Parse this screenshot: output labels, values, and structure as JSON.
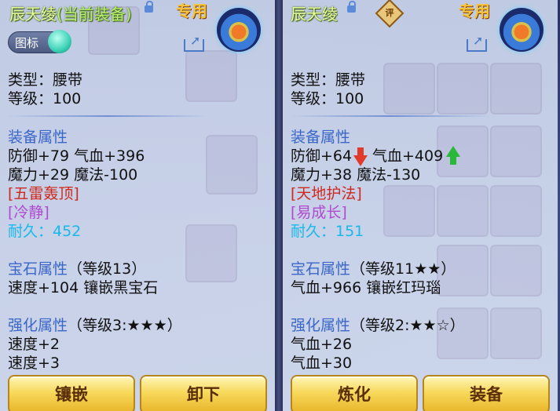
{
  "left": {
    "name": "辰天绫",
    "status": "(当前装备)",
    "exclusive": "专用",
    "tag_label": "图标",
    "type_line": "类型：腰带",
    "level_line": "等级：100",
    "attr_title": "装备属性",
    "attr_line1": "防御+79 气血+396",
    "attr_line2": "魔力+29 魔法-100",
    "skill": "[五雷轰顶]",
    "special": "[冷静]",
    "durability": "耐久：452",
    "gem_title": "宝石属性",
    "gem_level": "（等级13）",
    "gem_line": "速度+104 镶嵌黑宝石",
    "enh_title": "强化属性",
    "enh_level": "（等级3:★★★）",
    "enh_line1": "速度+2",
    "enh_line2": "速度+3",
    "btn1": "镶嵌",
    "btn2": "卸下"
  },
  "right": {
    "name": "辰天绫",
    "rating": "评",
    "exclusive": "专用",
    "type_line": "类型：腰带",
    "level_line": "等级：100",
    "attr_title": "装备属性",
    "attr_line1a": "防御+64",
    "attr_line1b": "气血+409",
    "attr_line2": "魔力+38 魔法-130",
    "skill": "[天地护法]",
    "special": "[易成长]",
    "durability": "耐久：151",
    "gem_title": "宝石属性",
    "gem_level": "（等级11★★）",
    "gem_line": "气血+966 镶嵌红玛瑙",
    "enh_title": "强化属性",
    "enh_level": "（等级2:★★☆）",
    "enh_line1": "气血+26",
    "enh_line2": "气血+30",
    "btn1": "炼化",
    "btn2": "装备"
  }
}
